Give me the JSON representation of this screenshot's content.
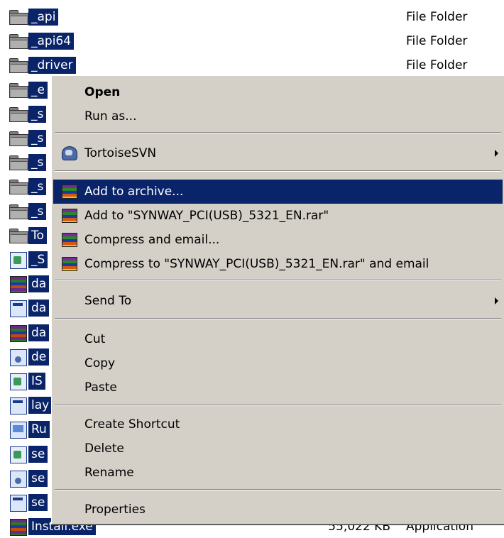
{
  "files": [
    {
      "name": "_api",
      "type": "File Folder",
      "icon": "folder-icon",
      "kind": "folder"
    },
    {
      "name": "_api64",
      "type": "File Folder",
      "icon": "folder-icon",
      "kind": "folder"
    },
    {
      "name": "_driver",
      "type": "File Folder",
      "icon": "folder-icon",
      "kind": "folder"
    },
    {
      "name": "_e",
      "type": "",
      "icon": "folder-icon",
      "kind": "folder"
    },
    {
      "name": "_s",
      "type": "",
      "icon": "folder-icon",
      "kind": "folder"
    },
    {
      "name": "_s",
      "type": "",
      "icon": "folder-icon",
      "kind": "folder"
    },
    {
      "name": "_s",
      "type": "",
      "icon": "folder-icon",
      "kind": "folder"
    },
    {
      "name": "_s",
      "type": "",
      "icon": "folder-icon",
      "kind": "folder"
    },
    {
      "name": "_s",
      "type": "",
      "icon": "folder-icon",
      "kind": "folder"
    },
    {
      "name": "To",
      "type": "",
      "icon": "folder-icon",
      "kind": "folder"
    },
    {
      "name": "_S",
      "type": "",
      "icon": "setup-file-icon",
      "kind": "doc"
    },
    {
      "name": "da",
      "type": "",
      "icon": "rar-archive-icon",
      "kind": "rar"
    },
    {
      "name": "da",
      "type": "",
      "icon": "window-file-icon",
      "kind": "win"
    },
    {
      "name": "da",
      "type": "",
      "icon": "rar-archive-icon",
      "kind": "rar"
    },
    {
      "name": "de",
      "type": "",
      "icon": "gear-file-icon",
      "kind": "gear"
    },
    {
      "name": "IS",
      "type": "",
      "icon": "setup-file-icon",
      "kind": "doc"
    },
    {
      "name": "lay",
      "type": "",
      "icon": "window-file-icon",
      "kind": "win"
    },
    {
      "name": "Ru",
      "type": "",
      "icon": "monitor-file-icon",
      "kind": "mon"
    },
    {
      "name": "se",
      "type": "",
      "icon": "install-file-icon",
      "kind": "doc"
    },
    {
      "name": "se",
      "type": "",
      "icon": "install-file-icon",
      "kind": "gear"
    },
    {
      "name": "se",
      "type": "",
      "icon": "window-file-icon",
      "kind": "win"
    },
    {
      "name": "Install.exe",
      "type": "Application",
      "size": "55,022 KB",
      "icon": "install-exe-icon",
      "kind": "rar"
    }
  ],
  "menu": {
    "open": "Open",
    "run_as": "Run as...",
    "tortoise": "TortoiseSVN",
    "add_archive": "Add to archive...",
    "add_to_rar": "Add to \"SYNWAY_PCI(USB)_5321_EN.rar\"",
    "compress_email": "Compress and email...",
    "compress_to_email": "Compress to \"SYNWAY_PCI(USB)_5321_EN.rar\" and email",
    "send_to": "Send To",
    "cut": "Cut",
    "copy": "Copy",
    "paste": "Paste",
    "create_shortcut": "Create Shortcut",
    "delete": "Delete",
    "rename": "Rename",
    "properties": "Properties"
  },
  "colors": {
    "selection": "#0a246a",
    "menu_bg": "#d4d0c8"
  }
}
